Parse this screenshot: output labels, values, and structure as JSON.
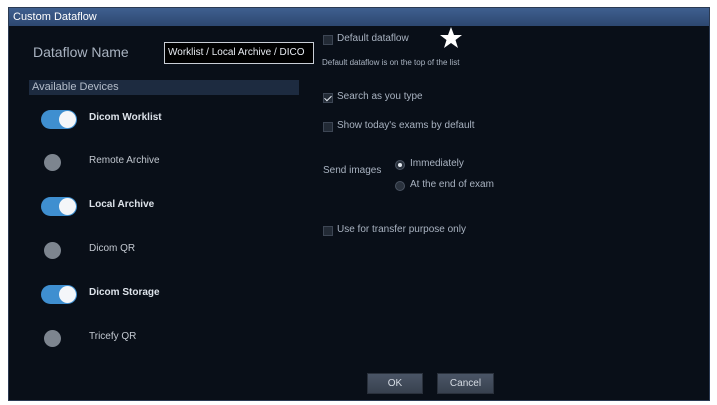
{
  "window": {
    "title": "Custom Dataflow"
  },
  "dataflow_name": {
    "label": "Dataflow Name",
    "value": "Worklist / Local Archive / DICO"
  },
  "devices": {
    "header": "Available Devices",
    "items": [
      {
        "label": "Dicom Worklist",
        "enabled": true
      },
      {
        "label": "Remote Archive",
        "enabled": false
      },
      {
        "label": "Local Archive",
        "enabled": true
      },
      {
        "label": "Dicom QR",
        "enabled": false
      },
      {
        "label": "Dicom Storage",
        "enabled": true
      },
      {
        "label": "Tricefy QR",
        "enabled": false
      }
    ]
  },
  "options": {
    "default_dataflow": {
      "label": "Default dataflow",
      "checked": false,
      "hint": "Default dataflow is on the top of the list",
      "star_icon": "star-icon"
    },
    "search_as_you_type": {
      "label": "Search as you type",
      "checked": true
    },
    "show_todays_exams": {
      "label": "Show today's exams by default",
      "checked": false
    },
    "send_images": {
      "label": "Send images",
      "choices": [
        {
          "label": "Immediately",
          "selected": true
        },
        {
          "label": "At the end of exam",
          "selected": false
        }
      ]
    },
    "transfer_only": {
      "label": "Use for transfer purpose only",
      "checked": false
    }
  },
  "buttons": {
    "ok": "OK",
    "cancel": "Cancel"
  },
  "colors": {
    "accent": "#3f8fd0",
    "background": "#090f18",
    "titlebar": "#3f5f8f"
  }
}
